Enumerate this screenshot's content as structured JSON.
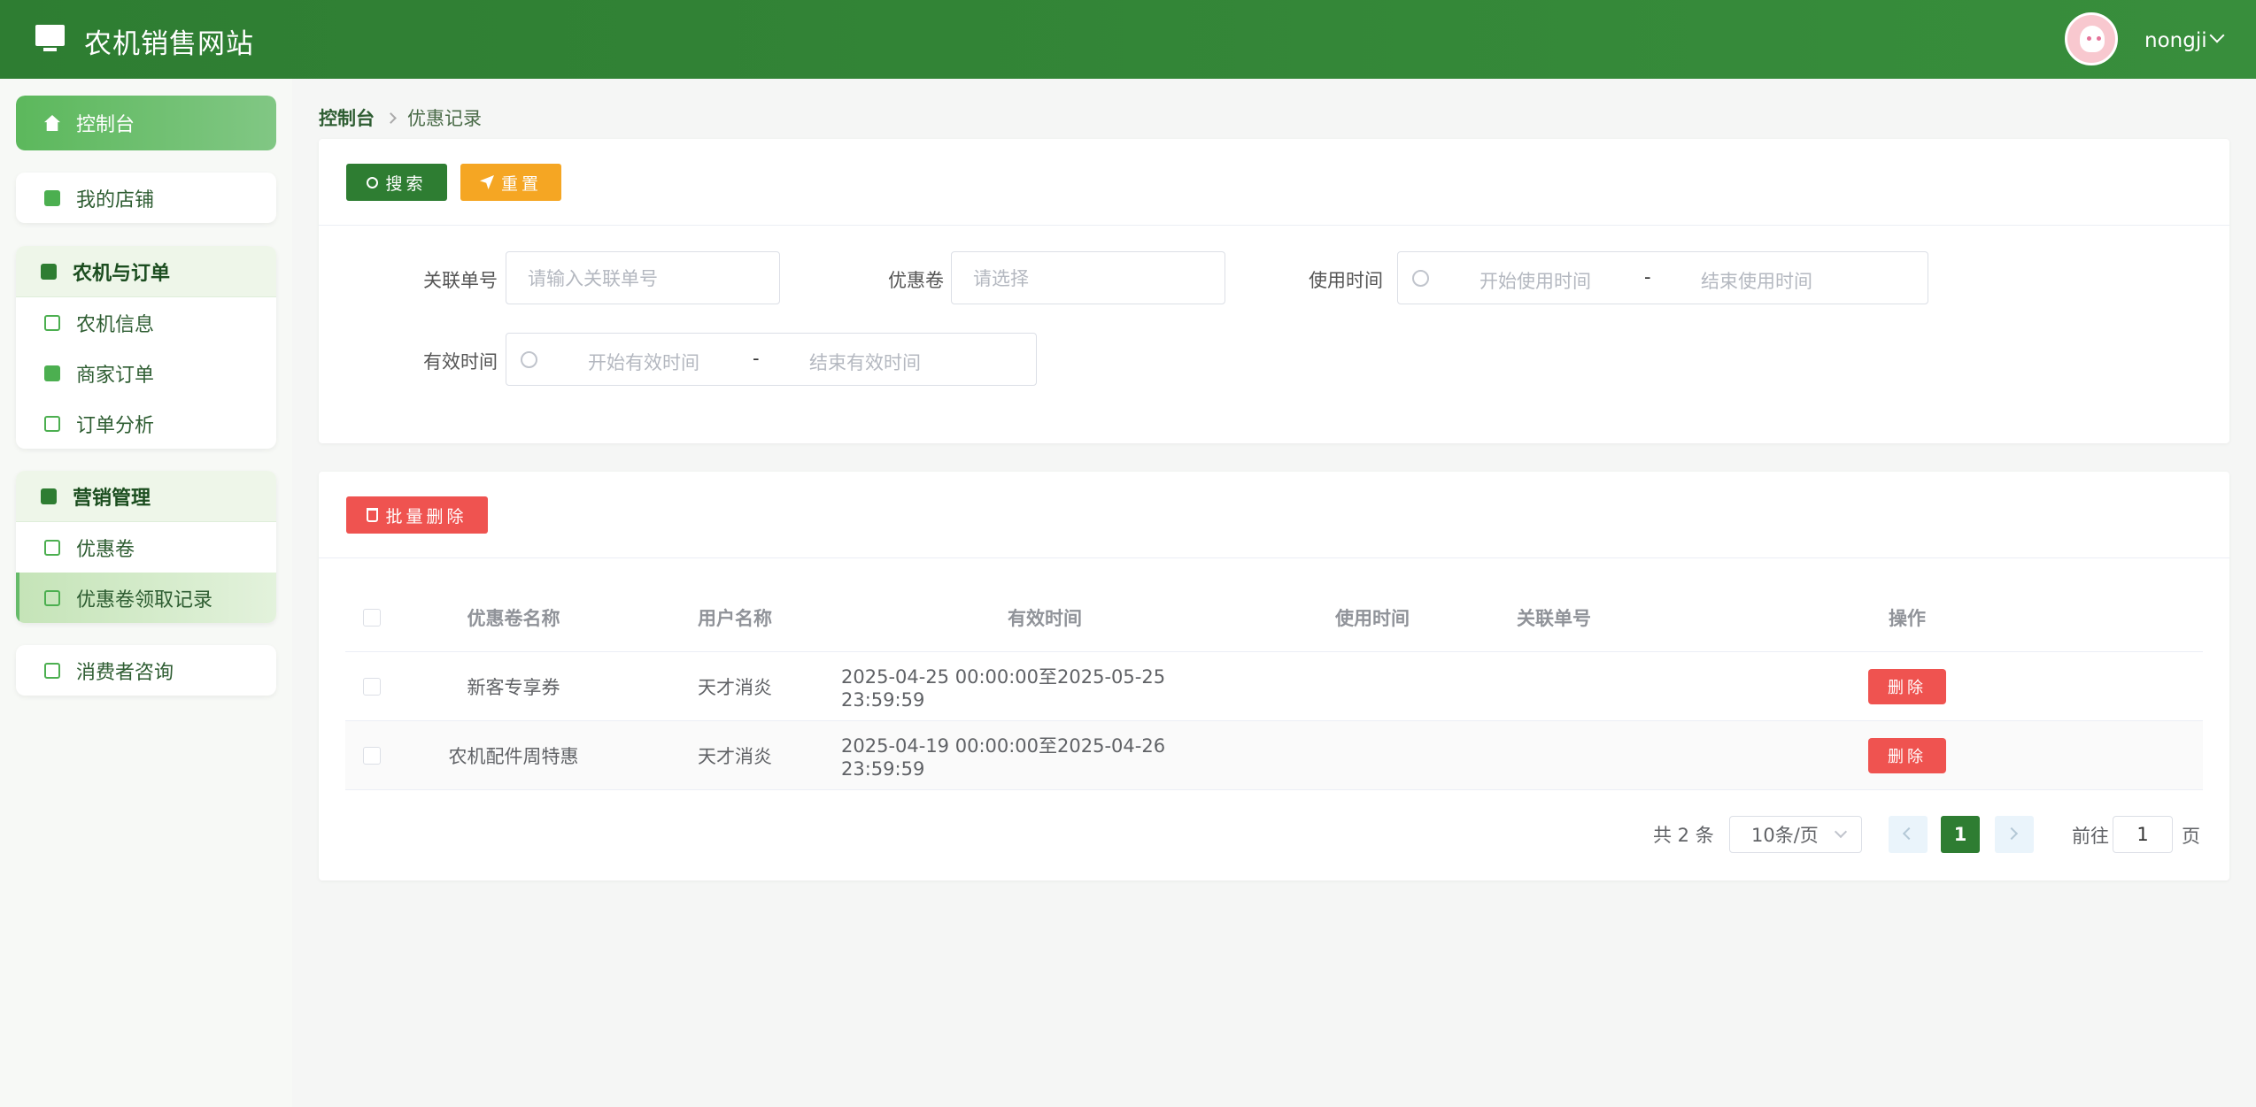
{
  "app": {
    "title": "农机销售网站",
    "username": "nongji"
  },
  "sidebar": {
    "home": "控制台",
    "shop": "我的店铺",
    "group1": {
      "title": "农机与订单",
      "items": [
        "农机信息",
        "商家订单",
        "订单分析"
      ]
    },
    "group2": {
      "title": "营销管理",
      "items": [
        "优惠卷",
        "优惠卷领取记录"
      ]
    },
    "consult": "消费者咨询"
  },
  "breadcrumb": {
    "root": "控制台",
    "current": "优惠记录"
  },
  "toolbar": {
    "search": "搜索",
    "reset": "重置",
    "batch_delete": "批量删除"
  },
  "filters": {
    "order_no": {
      "label": "关联单号",
      "placeholder": "请输入关联单号"
    },
    "coupon": {
      "label": "优惠卷",
      "placeholder": "请选择"
    },
    "use_time": {
      "label": "使用时间",
      "start": "开始使用时间",
      "sep": "-",
      "end": "结束使用时间"
    },
    "valid_time": {
      "label": "有效时间",
      "start": "开始有效时间",
      "sep": "-",
      "end": "结束有效时间"
    }
  },
  "table": {
    "headers": [
      "优惠卷名称",
      "用户名称",
      "有效时间",
      "使用时间",
      "关联单号",
      "操作"
    ],
    "rows": [
      {
        "name": "新客专享券",
        "user": "天才消炎",
        "valid": "2025-04-25 00:00:00至2025-05-25 23:59:59",
        "used": "",
        "order": "",
        "action": "删除"
      },
      {
        "name": "农机配件周特惠",
        "user": "天才消炎",
        "valid": "2025-04-19 00:00:00至2025-04-26 23:59:59",
        "used": "",
        "order": "",
        "action": "删除"
      }
    ]
  },
  "pagination": {
    "total": "共 2 条",
    "page_size": "10条/页",
    "current": "1",
    "goto_label": "前往",
    "goto_value": "1",
    "page_label": "页"
  },
  "colors": {
    "primary": "#2e7d32",
    "warning": "#f5a623",
    "danger": "#ef5350"
  }
}
